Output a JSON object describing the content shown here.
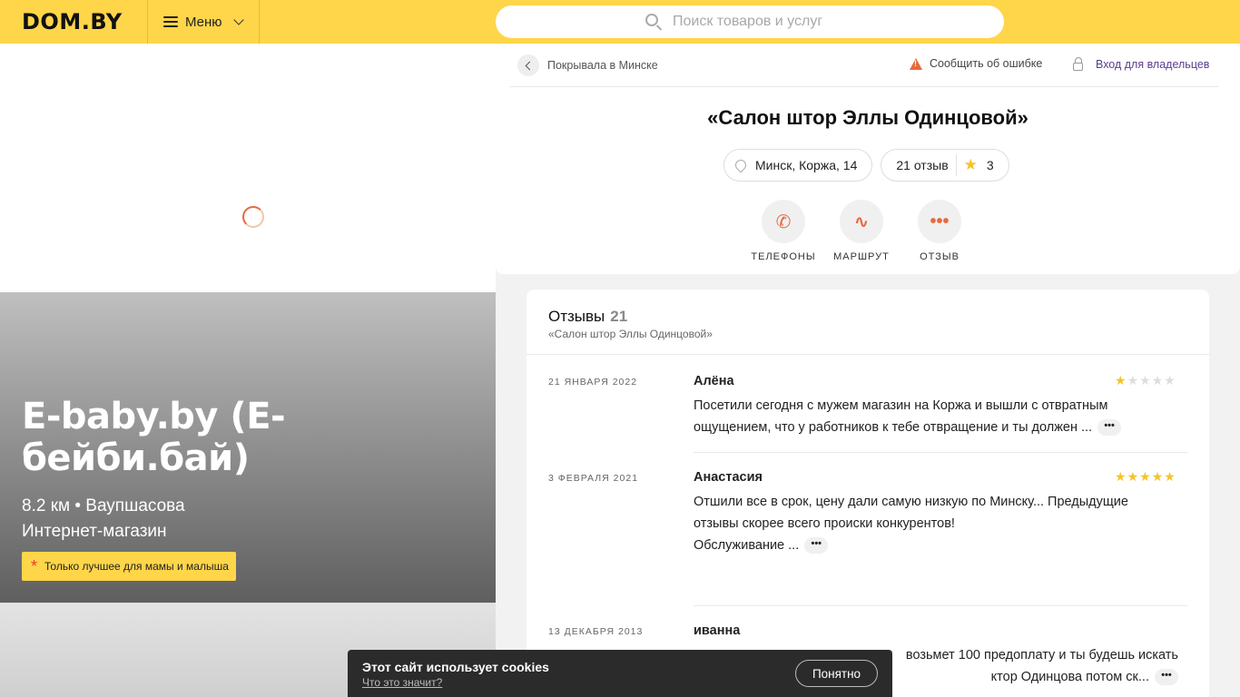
{
  "header": {
    "logo": "DOM.BY",
    "menu_label": "Меню",
    "search_placeholder": "Поиск товаров и услуг"
  },
  "promo": {
    "title": "E-baby.by (E-бейби.бай)",
    "distance_line": "8.2 км • Ваупшасова",
    "category": "Интернет-магазин",
    "badge": "Только лучшее для мамы и малыша"
  },
  "company": {
    "breadcrumb": "Покрывала в Минске",
    "report_error": "Сообщить об ошибке",
    "owner_login": "Вход для владельцев",
    "title": "«Салон штор Эллы Одинцовой»",
    "address": "Минск, Коржа, 14",
    "reviews_chip": "21 отзыв",
    "rating": "3",
    "actions": {
      "phones": "ТЕЛЕФОНЫ",
      "route": "МАРШРУТ",
      "review": "ОТЗЫВ"
    }
  },
  "reviews": {
    "heading": "Отзывы",
    "count": "21",
    "subtitle": "«Салон штор Эллы Одинцовой»",
    "items": [
      {
        "date": "21 ЯНВАРЯ 2022",
        "author": "Алёна",
        "stars": 1,
        "line1": "Посетили сегодня с мужем магазин на Коржа и вышли с отвратным",
        "line2": "ощущением, что у работников к тебе отвращение и ты должен ...",
        "line3": ""
      },
      {
        "date": "3 ФЕВРАЛЯ 2021",
        "author": "Анастасия",
        "stars": 5,
        "line1": "Отшили все в срок, цену дали самую низкую по Минску... Предыдущие",
        "line2": "отзывы скорее всего происки конкурентов!",
        "line3": "Обслуживание ..."
      },
      {
        "date": "13 ДЕКАБРЯ 2013",
        "author": "иванна",
        "stars": null,
        "line1": "возьмет 100 предоплату и ты будешь искать",
        "line2": "ктор Одинцова потом ск...",
        "line3": ""
      }
    ]
  },
  "cookie": {
    "title": "Этот сайт использует cookies",
    "link": "Что это значит?",
    "button": "Понятно"
  },
  "colors": {
    "brand_yellow": "#ffd54a",
    "accent_orange": "#e9683b",
    "star_yellow": "#f4c32a",
    "owner_link": "#5c3d8f"
  }
}
